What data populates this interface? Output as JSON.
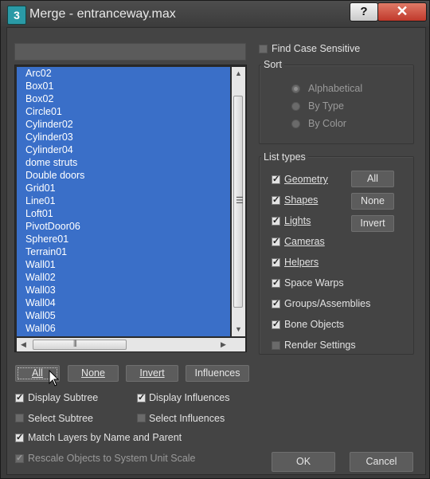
{
  "window": {
    "title": "Merge - entranceway.max",
    "app_icon_glyph": "3",
    "help_label": "?",
    "close_label": "✕"
  },
  "filter": {
    "value": ""
  },
  "objects": [
    "Arc02",
    "Box01",
    "Box02",
    "Circle01",
    "Cylinder02",
    "Cylinder03",
    "Cylinder04",
    "dome struts",
    "Double doors",
    "Grid01",
    "Line01",
    "Loft01",
    "PivotDoor06",
    "Sphere01",
    "Terrain01",
    "Wall01",
    "Wall02",
    "Wall03",
    "Wall04",
    "Wall05",
    "Wall06"
  ],
  "list_buttons": {
    "all": "All",
    "none": "None",
    "invert": "Invert",
    "influences": "Influences"
  },
  "options": {
    "display_subtree": "Display Subtree",
    "display_influences": "Display Influences",
    "select_subtree": "Select Subtree",
    "select_influences": "Select Influences",
    "match_layers": "Match Layers by Name and Parent",
    "rescale": "Rescale Objects to System Unit Scale"
  },
  "find_case_sensitive": "Find Case Sensitive",
  "sort": {
    "label": "Sort",
    "alphabetical": "Alphabetical",
    "by_type": "By Type",
    "by_color": "By Color"
  },
  "list_types": {
    "label": "List types",
    "geometry": "Geometry",
    "shapes": "Shapes",
    "lights": "Lights",
    "cameras": "Cameras",
    "helpers": "Helpers",
    "space_warps": "Space Warps",
    "groups": "Groups/Assemblies",
    "bone_objects": "Bone Objects",
    "render_settings": "Render Settings",
    "all": "All",
    "none": "None",
    "invert": "Invert"
  },
  "footer": {
    "ok": "OK",
    "cancel": "Cancel"
  }
}
